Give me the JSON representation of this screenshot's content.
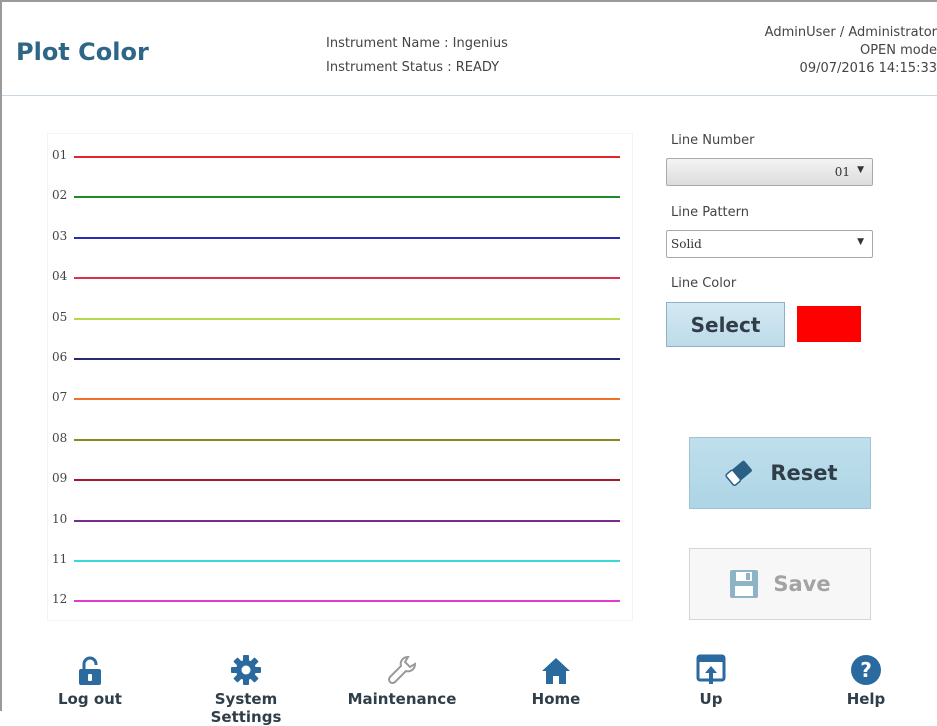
{
  "header": {
    "title": "Plot Color",
    "instrument_name": "Instrument Name : Ingenius",
    "instrument_status": "Instrument Status : READY",
    "user": "AdminUser / Administrator",
    "mode": "OPEN mode",
    "datetime": "09/07/2016 14:15:33"
  },
  "plot": {
    "lines": [
      {
        "label": "01",
        "color": "#e0262a"
      },
      {
        "label": "02",
        "color": "#1f8a2a"
      },
      {
        "label": "03",
        "color": "#2a2ab5"
      },
      {
        "label": "04",
        "color": "#d8324e"
      },
      {
        "label": "05",
        "color": "#b5d84a"
      },
      {
        "label": "06",
        "color": "#26287a"
      },
      {
        "label": "07",
        "color": "#f0712a"
      },
      {
        "label": "08",
        "color": "#8a8a1c"
      },
      {
        "label": "09",
        "color": "#a3182a"
      },
      {
        "label": "10",
        "color": "#7a2a8f"
      },
      {
        "label": "11",
        "color": "#3ad8d8"
      },
      {
        "label": "12",
        "color": "#e03ad0"
      }
    ]
  },
  "panel": {
    "line_number_label": "Line Number",
    "line_number_value": "01",
    "line_pattern_label": "Line Pattern",
    "line_pattern_value": "Solid",
    "line_color_label": "Line Color",
    "select_label": "Select",
    "selected_color": "#ff0000",
    "reset_label": "Reset",
    "save_label": "Save"
  },
  "nav": {
    "items": [
      {
        "label": "Log out",
        "icon": "unlock-icon"
      },
      {
        "label": "System Settings",
        "icon": "gear-icon"
      },
      {
        "label": "Maintenance",
        "icon": "wrench-icon"
      },
      {
        "label": "Home",
        "icon": "home-icon"
      },
      {
        "label": "Up",
        "icon": "up-window-icon"
      },
      {
        "label": "Help",
        "icon": "help-icon"
      }
    ]
  }
}
